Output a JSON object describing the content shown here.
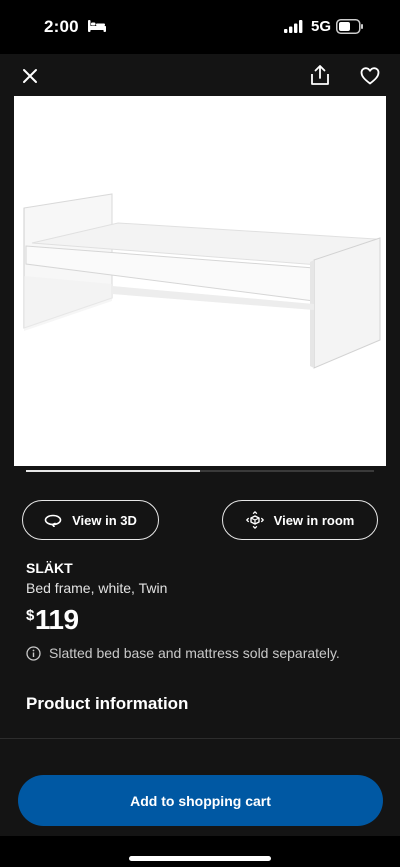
{
  "status_bar": {
    "time": "2:00",
    "network": "5G",
    "icons": [
      "bed-icon",
      "signal-icon",
      "battery-icon"
    ]
  },
  "app_bar": {
    "icons": [
      "close-icon",
      "share-icon",
      "heart-icon"
    ]
  },
  "product": {
    "image_icon": "bed-frame-image",
    "carousel_progress": 0.5,
    "view_3d_label": "View in 3D",
    "view_room_label": "View in room",
    "name": "SLÄKT",
    "description": "Bed frame, white, Twin",
    "price_currency": "$",
    "price_amount": "119",
    "notice": "Slatted bed base and mattress sold separately."
  },
  "sections": {
    "product_information": "Product information"
  },
  "cta": {
    "add_to_cart": "Add to shopping cart"
  },
  "colors": {
    "background": "#141414",
    "primary_blue": "#0058a3",
    "text": "#ffffff"
  }
}
